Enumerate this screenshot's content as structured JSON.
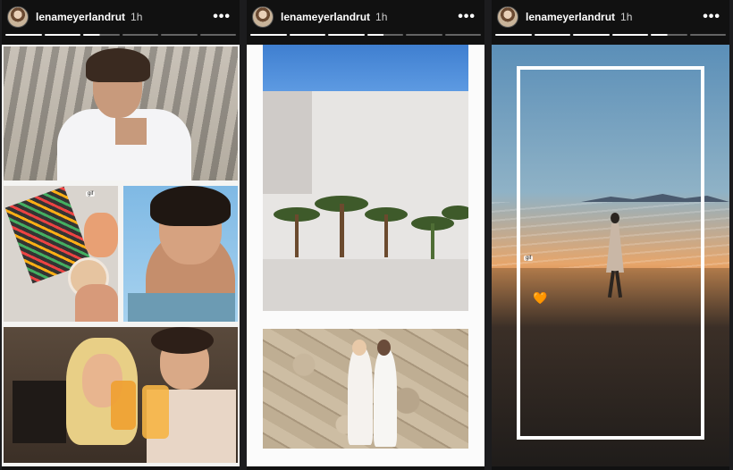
{
  "stories": [
    {
      "username": "lenameyerlandrut",
      "time": "1h",
      "more": "•••",
      "progress": [
        1,
        1,
        0.5,
        0,
        0,
        0
      ]
    },
    {
      "username": "lenameyerlandrut",
      "time": "1h",
      "more": "•••",
      "progress": [
        1,
        1,
        1,
        0.5,
        0,
        0
      ]
    },
    {
      "username": "lenameyerlandrut",
      "time": "1h",
      "more": "•••",
      "progress": [
        1,
        1,
        1,
        1,
        0.5,
        0
      ]
    }
  ],
  "stickers": {
    "gif_tag": "gif",
    "heart": "🧡"
  },
  "icons": {
    "more": "more-options-icon",
    "avatar": "profile-avatar"
  }
}
